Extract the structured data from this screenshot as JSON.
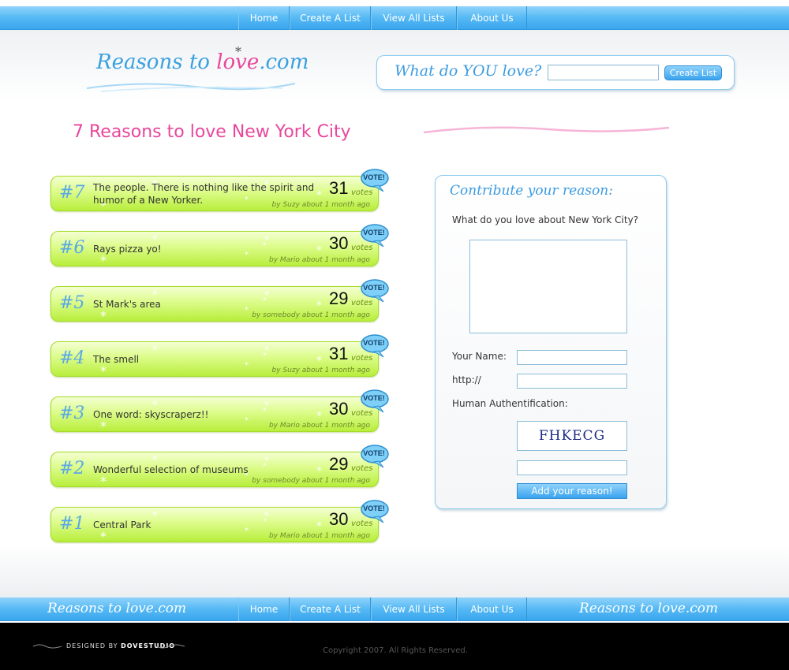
{
  "nav": {
    "items": [
      {
        "label": "Home"
      },
      {
        "label": "Create A List"
      },
      {
        "label": "View All Lists"
      },
      {
        "label": "About Us"
      }
    ]
  },
  "header": {
    "logo_text": "Reasons to ",
    "logo_love": "love",
    "logo_tld": ".com",
    "logo_star": "*",
    "search_prompt": "What do YOU love?",
    "search_value": "",
    "create_button": "Create List"
  },
  "page_title": "7 Reasons to love New York City",
  "reasons": [
    {
      "rank": "#7",
      "text": "The people. There is nothing like the spirit and humor of a New Yorker.",
      "votes": "31",
      "votes_label": "votes",
      "byline": "by Suzy about 1 month ago",
      "vote_button": "VOTE!"
    },
    {
      "rank": "#6",
      "text": "Rays pizza yo!",
      "votes": "30",
      "votes_label": "votes",
      "byline": "by Mario about 1 month ago",
      "vote_button": "VOTE!"
    },
    {
      "rank": "#5",
      "text": "St Mark's area",
      "votes": "29",
      "votes_label": "votes",
      "byline": "by somebody about 1 month ago",
      "vote_button": "VOTE!"
    },
    {
      "rank": "#4",
      "text": "The smell",
      "votes": "31",
      "votes_label": "votes",
      "byline": "by Suzy about 1 month ago",
      "vote_button": "VOTE!"
    },
    {
      "rank": "#3",
      "text": "One word: skyscraperz!!",
      "votes": "30",
      "votes_label": "votes",
      "byline": "by Mario about 1 month ago",
      "vote_button": "VOTE!"
    },
    {
      "rank": "#2",
      "text": "Wonderful selection of museums",
      "votes": "29",
      "votes_label": "votes",
      "byline": "by somebody about 1 month ago",
      "vote_button": "VOTE!"
    },
    {
      "rank": "#1",
      "text": "Central Park",
      "votes": "30",
      "votes_label": "votes",
      "byline": "by Mario about 1 month ago",
      "vote_button": "VOTE!"
    }
  ],
  "contribute": {
    "heading": "Contribute your reason:",
    "question": "What do you love about New York City?",
    "name_label": "Your Name:",
    "url_label": "http://",
    "auth_label": "Human Authentification:",
    "captcha_text": "FHKECG",
    "submit_label": "Add your reason!"
  },
  "footer": {
    "bar_logo": "Reasons to love.com",
    "designed_by": "DESIGNED BY",
    "designer": "DOVESTUDIO",
    "copyright": "Copyright 2007. All Rights Reserved."
  },
  "colors": {
    "nav_blue": "#4fb4f3",
    "title_pink": "#e8479c",
    "accent_blue": "#3b9be0",
    "card_green": "#c8f25a"
  }
}
